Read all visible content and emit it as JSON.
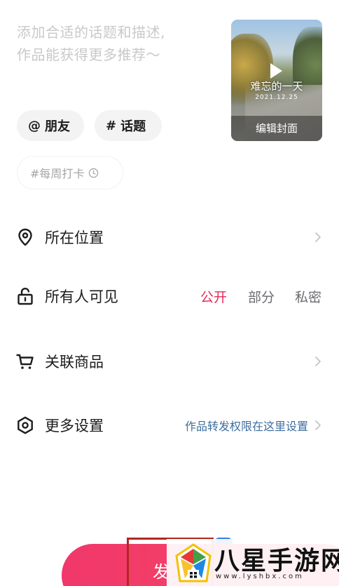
{
  "description": {
    "placeholder_line1": "添加合适的话题和描述,",
    "placeholder_line2": "作品能获得更多推荐～"
  },
  "cover": {
    "overlay_title": "难忘的一天",
    "overlay_date": "2021.12.25",
    "edit_label": "编辑封面"
  },
  "chips": {
    "friends_symbol": "@",
    "friends_label": "朋友",
    "topic_symbol": "#",
    "topic_label": "话题",
    "weekly_label": "#每周打卡"
  },
  "settings": {
    "location_label": "所在位置",
    "visibility_label": "所有人可见",
    "visibility_options": [
      "公开",
      "部分",
      "私密"
    ],
    "visibility_selected": "公开",
    "products_label": "关联商品",
    "more_label": "更多设置",
    "more_hint": "作品转发权限在这里设置"
  },
  "publish": {
    "label": "发"
  },
  "watermark": {
    "title": "八星手游网",
    "url": "www.lyshbx.com"
  },
  "colors": {
    "accent": "#e22a5c",
    "publish_button": "#f1376b",
    "link_blue": "#3f6e9f",
    "placeholder": "#c9c9cc"
  },
  "icons": {
    "location": "map-pin-icon",
    "visibility": "unlock-icon",
    "products": "cart-icon",
    "more": "settings-hexagon-icon",
    "chevron": "chevron-right-icon",
    "clock": "clock-icon",
    "play": "play-icon"
  }
}
